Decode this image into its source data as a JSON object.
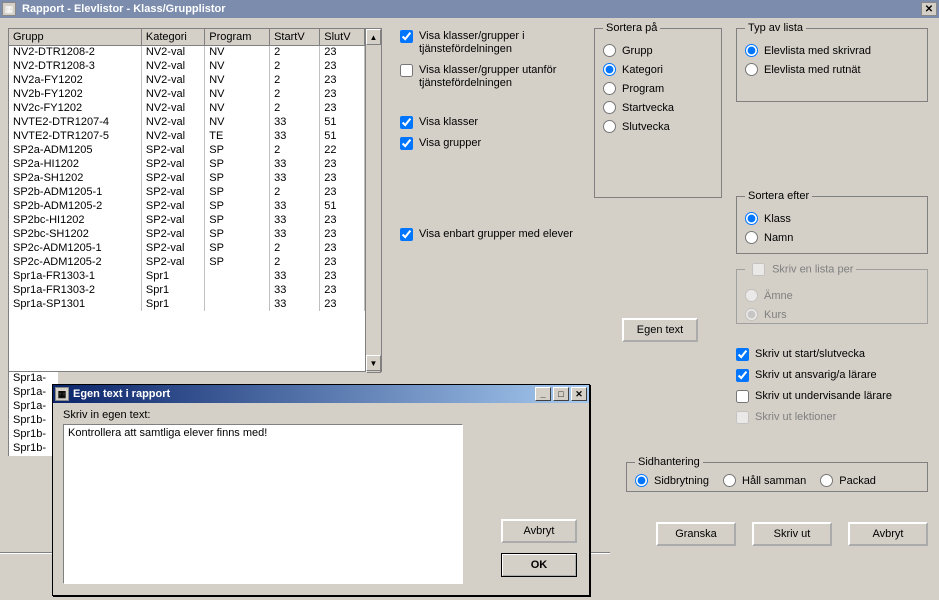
{
  "window": {
    "title": "Rapport -  Elevlistor - Klass/Grupplistor"
  },
  "table": {
    "columns": [
      "Grupp",
      "Kategori",
      "Program",
      "StartV",
      "SlutV"
    ],
    "rows": [
      [
        "NV2-DTR1208-2",
        "NV2-val",
        "NV",
        "2",
        "23"
      ],
      [
        "NV2-DTR1208-3",
        "NV2-val",
        "NV",
        "2",
        "23"
      ],
      [
        "NV2a-FY1202",
        "NV2-val",
        "NV",
        "2",
        "23"
      ],
      [
        "NV2b-FY1202",
        "NV2-val",
        "NV",
        "2",
        "23"
      ],
      [
        "NV2c-FY1202",
        "NV2-val",
        "NV",
        "2",
        "23"
      ],
      [
        "NVTE2-DTR1207-4",
        "NV2-val",
        "NV",
        "33",
        "51"
      ],
      [
        "NVTE2-DTR1207-5",
        "NV2-val",
        "TE",
        "33",
        "51"
      ],
      [
        "SP2a-ADM1205",
        "SP2-val",
        "SP",
        "2",
        "22"
      ],
      [
        "SP2a-HI1202",
        "SP2-val",
        "SP",
        "33",
        "23"
      ],
      [
        "SP2a-SH1202",
        "SP2-val",
        "SP",
        "33",
        "23"
      ],
      [
        "SP2b-ADM1205-1",
        "SP2-val",
        "SP",
        "2",
        "23"
      ],
      [
        "SP2b-ADM1205-2",
        "SP2-val",
        "SP",
        "33",
        "51"
      ],
      [
        "SP2bc-HI1202",
        "SP2-val",
        "SP",
        "33",
        "23"
      ],
      [
        "SP2bc-SH1202",
        "SP2-val",
        "SP",
        "33",
        "23"
      ],
      [
        "SP2c-ADM1205-1",
        "SP2-val",
        "SP",
        "2",
        "23"
      ],
      [
        "SP2c-ADM1205-2",
        "SP2-val",
        "SP",
        "2",
        "23"
      ],
      [
        "Spr1a-FR1303-1",
        "Spr1",
        "",
        "33",
        "23"
      ],
      [
        "Spr1a-FR1303-2",
        "Spr1",
        "",
        "33",
        "23"
      ],
      [
        "Spr1a-SP1301",
        "Spr1",
        "",
        "33",
        "23"
      ]
    ],
    "peek_rows": [
      "Spr1a-",
      "Spr1a-",
      "Spr1a-",
      "Spr1b-",
      "Spr1b-",
      "Spr1b-"
    ]
  },
  "checks_left": {
    "c1": {
      "label": "Visa klasser/grupper i tjänstefördelningen",
      "checked": true
    },
    "c2": {
      "label": "Visa klasser/grupper utanför tjänstefördelningen",
      "checked": false
    },
    "c3": {
      "label": "Visa klasser",
      "checked": true
    },
    "c4": {
      "label": "Visa grupper",
      "checked": true
    }
  },
  "visa_enbart": {
    "label": "Visa enbart grupper med elever",
    "checked": true
  },
  "sort_on": {
    "legend": "Sortera på",
    "options": [
      "Grupp",
      "Kategori",
      "Program",
      "Startvecka",
      "Slutvecka"
    ],
    "selected": "Kategori"
  },
  "typ_lista": {
    "legend": "Typ av lista",
    "options": [
      "Elevlista med skrivrad",
      "Elevlista med rutnät"
    ],
    "selected": "Elevlista med skrivrad"
  },
  "sort_efter": {
    "legend": "Sortera efter",
    "options": [
      "Klass",
      "Namn"
    ],
    "selected": "Klass"
  },
  "skriv_per": {
    "legend": "Skriv en lista per",
    "options": [
      "Ämne",
      "Kurs"
    ],
    "selected": "Kurs"
  },
  "checks_right": {
    "r1": {
      "label": "Skriv ut start/slutvecka",
      "checked": true
    },
    "r2": {
      "label": "Skriv ut ansvarig/a lärare",
      "checked": true
    },
    "r3": {
      "label": "Skriv ut undervisande lärare",
      "checked": false
    },
    "r4": {
      "label": "Skriv ut lektioner",
      "checked": false,
      "disabled": true
    }
  },
  "sidhantering": {
    "legend": "Sidhantering",
    "options": [
      "Sidbrytning",
      "Håll samman",
      "Packad"
    ],
    "selected": "Sidbrytning"
  },
  "egen_text_btn": "Egen text",
  "main_buttons": {
    "granska": "Granska",
    "skrivut": "Skriv ut",
    "avbryt": "Avbryt"
  },
  "dialog": {
    "title": "Egen text i rapport",
    "label": "Skriv in egen text:",
    "text": "Kontrollera att samtliga elever finns med!",
    "cancel": "Avbryt",
    "ok": "OK"
  }
}
